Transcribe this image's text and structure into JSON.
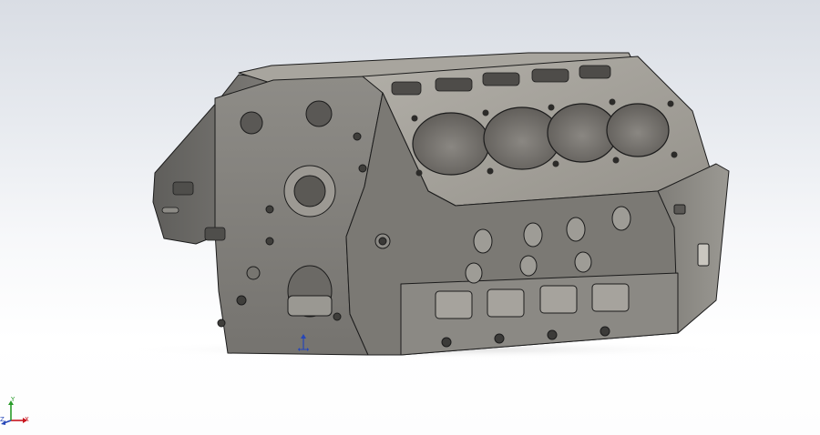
{
  "viewport": {
    "background_top": "#d9dde4",
    "background_bottom": "#ffffff",
    "model": {
      "part": "V8 engine block",
      "shaded_color": "#8c8a85",
      "deck_color": "#a19e97",
      "bore_color": "#6f6c67",
      "edge_color": "#1c1c1c",
      "cylinder_bores_visible": 4
    },
    "triad": {
      "x_label": "X",
      "y_label": "Y",
      "z_label": "Z",
      "x_color": "#c8141e",
      "y_color": "#2a9c2a",
      "z_color": "#2646b8"
    },
    "origin_marker": {
      "icon": "origin-arrow-icon",
      "color": "#2646b8"
    }
  }
}
